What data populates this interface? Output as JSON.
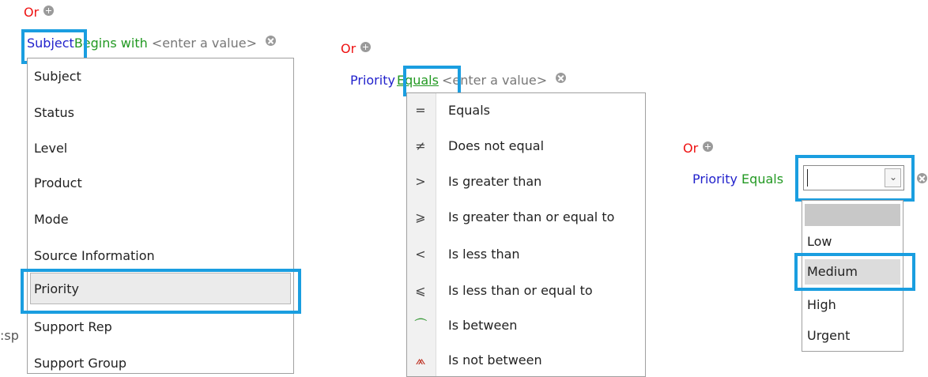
{
  "rule1": {
    "or": "Or",
    "field": "Subject",
    "operator": "Begins with",
    "value_placeholder": "<enter a value>"
  },
  "field_menu": {
    "items": [
      "Subject",
      "Status",
      "Level",
      "Product",
      "Mode",
      "Source Information",
      "Priority",
      "Support Rep",
      "Support Group"
    ],
    "selected": "Priority"
  },
  "rule2": {
    "or": "Or",
    "field": "Priority",
    "operator": "Equals",
    "value_placeholder": "<enter a value>"
  },
  "operator_menu": {
    "items": [
      {
        "icon": "equals-icon",
        "glyph": "=",
        "label": "Equals"
      },
      {
        "icon": "not-equal-icon",
        "glyph": "≠",
        "label": "Does not equal"
      },
      {
        "icon": "greater-than-icon",
        "glyph": ">",
        "label": "Is greater than"
      },
      {
        "icon": "greater-equal-icon",
        "glyph": "⩾",
        "label": "Is greater than or equal to"
      },
      {
        "icon": "less-than-icon",
        "glyph": "<",
        "label": "Is less than"
      },
      {
        "icon": "less-equal-icon",
        "glyph": "⩽",
        "label": "Is less than or equal to"
      },
      {
        "icon": "between-icon",
        "glyph": "⏜",
        "label": "Is between"
      },
      {
        "icon": "not-between-icon",
        "glyph": "⩕",
        "label": "Is not between"
      }
    ]
  },
  "rule3": {
    "or": "Or",
    "field": "Priority",
    "operator": "Equals",
    "select_value": ""
  },
  "value_dropdown": {
    "options": [
      "",
      "Low",
      "Medium",
      "High",
      "Urgent"
    ],
    "selected": "Medium"
  },
  "partial_text": ":sp",
  "colors": {
    "highlight": "#1a9ee0",
    "or": "#ee1111",
    "field": "#2222cc",
    "operator": "#229922"
  }
}
